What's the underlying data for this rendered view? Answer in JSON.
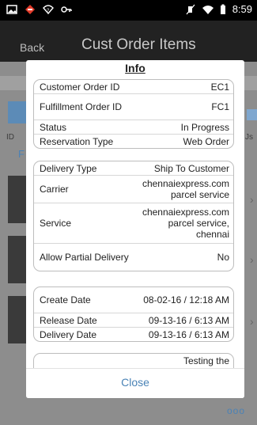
{
  "status_bar": {
    "time": "8:59"
  },
  "app_bar": {
    "back_label": "Back",
    "title": "Cust Order Items"
  },
  "background": {
    "left_label": "ID",
    "right_label": "Js",
    "left_f": "F",
    "more_dots": "ooo"
  },
  "dialog": {
    "title": "Info",
    "close_label": "Close",
    "sections": [
      {
        "rows": [
          {
            "label": "Customer Order ID",
            "value": "EC1"
          },
          {
            "label": "Fulfillment Order ID",
            "value": "FC1"
          },
          {
            "label": "Status",
            "value": "In Progress"
          },
          {
            "label": "Reservation Type",
            "value": "Web Order"
          }
        ]
      },
      {
        "rows": [
          {
            "label": "Delivery Type",
            "value": "Ship To Customer"
          },
          {
            "label": "Carrier",
            "value": "chennaiexpress.com parcel service"
          },
          {
            "label": "Service",
            "value": "chennaiexpress.com parcel service, chennai"
          },
          {
            "label": "Allow Partial Delivery",
            "value": "No"
          }
        ]
      },
      {
        "rows": [
          {
            "label": "Create Date",
            "value": "08-02-16 / 12:18 AM"
          },
          {
            "label": "Release Date",
            "value": "09-13-16 / 6:13 AM"
          },
          {
            "label": "Delivery Date",
            "value": "09-13-16 / 6:13 AM"
          }
        ]
      },
      {
        "rows": [
          {
            "label": "",
            "value": "Testing the"
          }
        ]
      }
    ]
  }
}
